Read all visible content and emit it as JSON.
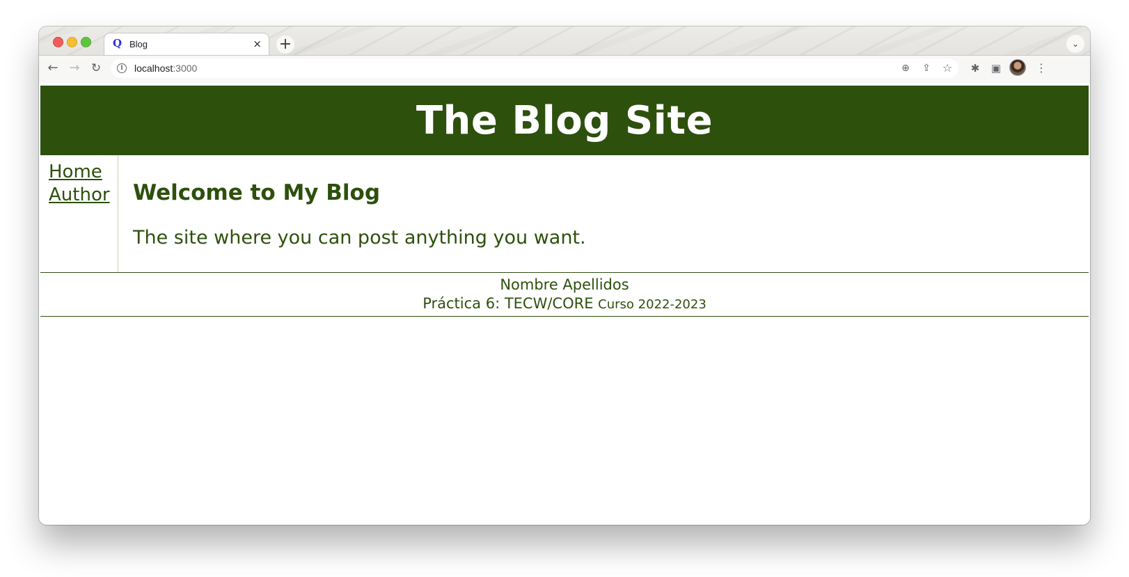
{
  "browser": {
    "tab": {
      "title": "Blog",
      "favicon_letter": "Q",
      "close_glyph": "×"
    },
    "new_tab_glyph": "+",
    "tabs_menu_glyph": "⌄",
    "toolbar": {
      "back_glyph": "←",
      "forward_glyph": "→",
      "reload_glyph": "↻",
      "info_glyph": "i",
      "url_host": "localhost",
      "url_port": ":3000",
      "zoom_glyph": "⊕",
      "share_glyph": "⇪",
      "star_glyph": "☆",
      "extensions_glyph": "✱",
      "sidepanel_glyph": "▣",
      "menu_glyph": "⋮"
    }
  },
  "site": {
    "title": "The Blog Site",
    "nav": [
      {
        "label": "Home"
      },
      {
        "label": "Author"
      }
    ],
    "main": {
      "heading": "Welcome to My Blog",
      "tagline": "The site where you can post anything you want."
    },
    "footer": {
      "name": "Nombre Apellidos",
      "assignment": "Práctica 6: TECW/CORE",
      "course": "Curso 2022-2023"
    }
  },
  "colors": {
    "brand_green": "#2d500d",
    "header_text": "#ffffff"
  }
}
